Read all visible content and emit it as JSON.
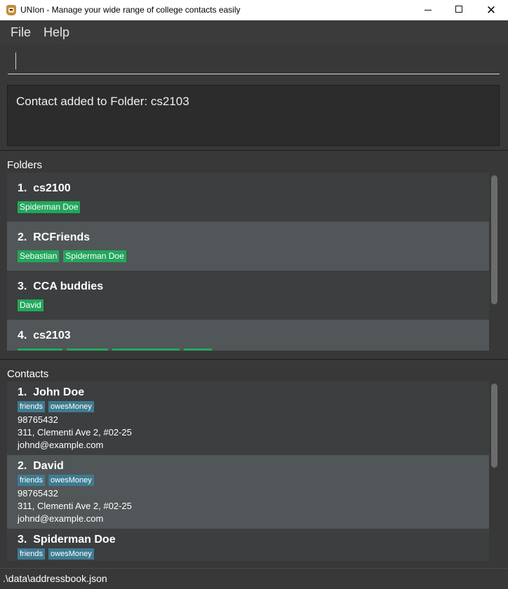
{
  "window": {
    "title": "UNIon - Manage your wide range of college contacts easily",
    "minimize_label": "",
    "close_label": "✕"
  },
  "menu": {
    "file_label": "File",
    "help_label": "Help"
  },
  "command": {
    "value": "",
    "placeholder": ""
  },
  "result": {
    "message": "Contact added to Folder: cs2103"
  },
  "folders": {
    "title": "Folders",
    "items": [
      {
        "index": "1.",
        "name": "cs2100",
        "tags": [
          "Spiderman Doe"
        ]
      },
      {
        "index": "2.",
        "name": "RCFriends",
        "tags": [
          "Sebastian",
          "Spiderman Doe"
        ]
      },
      {
        "index": "3.",
        "name": "CCA buddies",
        "tags": [
          "David"
        ]
      },
      {
        "index": "4.",
        "name": "cs2103",
        "tags": []
      }
    ]
  },
  "contacts": {
    "title": "Contacts",
    "items": [
      {
        "index": "1.",
        "name": "John Doe",
        "tags": [
          "friends",
          "owesMoney"
        ],
        "phone": "98765432",
        "address": "311, Clementi Ave 2, #02-25",
        "email": "johnd@example.com"
      },
      {
        "index": "2.",
        "name": "David",
        "tags": [
          "friends",
          "owesMoney"
        ],
        "phone": "98765432",
        "address": "311, Clementi Ave 2, #02-25",
        "email": "johnd@example.com"
      },
      {
        "index": "3.",
        "name": "Spiderman Doe",
        "tags": [
          "friends",
          "owesMoney"
        ],
        "phone": "",
        "address": "",
        "email": ""
      }
    ]
  },
  "status": {
    "path": ".\\data\\addressbook.json"
  },
  "colors": {
    "folder_tag": "#23a75c",
    "contact_tag": "#3e7b91",
    "card_light": "#515658",
    "card_dark": "#3c3e3f"
  }
}
